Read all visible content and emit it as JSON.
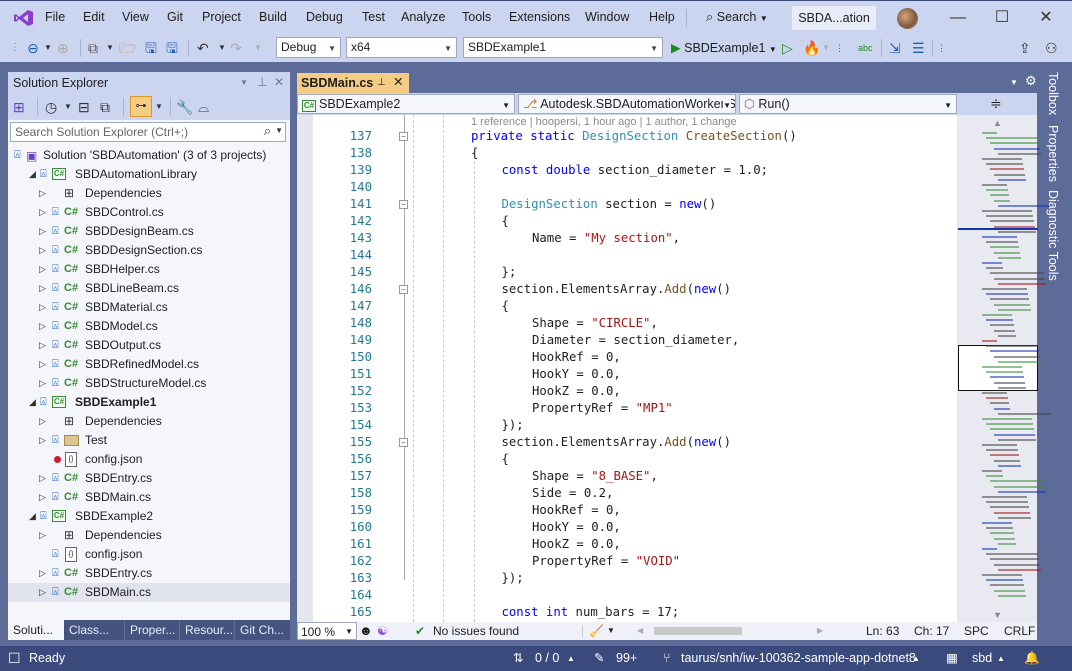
{
  "menu": {
    "items": [
      "File",
      "Edit",
      "View",
      "Git",
      "Project",
      "Build",
      "Debug",
      "Test",
      "Analyze",
      "Tools",
      "Extensions",
      "Window",
      "Help"
    ],
    "search_label": "Search",
    "title_pill": "SBDA...ation"
  },
  "toolbar": {
    "config": "Debug",
    "platform": "x64",
    "startup_project": "SBDExample1",
    "run_label": "SBDExample1"
  },
  "solution_explorer": {
    "title": "Solution Explorer",
    "search_placeholder": "Search Solution Explorer (Ctrl+;)",
    "tree": [
      {
        "label": "Solution 'SBDAutomation' (3 of 3 projects)",
        "kind": "solution",
        "level": 0
      },
      {
        "label": "SBDAutomationLibrary",
        "kind": "project",
        "level": 1,
        "expanded": true
      },
      {
        "label": "Dependencies",
        "kind": "deps",
        "level": 2
      },
      {
        "label": "SBDControl.cs",
        "kind": "cs",
        "level": 2
      },
      {
        "label": "SBDDesignBeam.cs",
        "kind": "cs",
        "level": 2
      },
      {
        "label": "SBDDesignSection.cs",
        "kind": "cs",
        "level": 2
      },
      {
        "label": "SBDHelper.cs",
        "kind": "cs",
        "level": 2
      },
      {
        "label": "SBDLineBeam.cs",
        "kind": "cs",
        "level": 2
      },
      {
        "label": "SBDMaterial.cs",
        "kind": "cs",
        "level": 2
      },
      {
        "label": "SBDModel.cs",
        "kind": "cs",
        "level": 2
      },
      {
        "label": "SBDOutput.cs",
        "kind": "cs",
        "level": 2
      },
      {
        "label": "SBDRefinedModel.cs",
        "kind": "cs",
        "level": 2
      },
      {
        "label": "SBDStructureModel.cs",
        "kind": "cs",
        "level": 2
      },
      {
        "label": "SBDExample1",
        "kind": "project",
        "level": 1,
        "expanded": true,
        "bold": true
      },
      {
        "label": "Dependencies",
        "kind": "deps",
        "level": 2
      },
      {
        "label": "Test",
        "kind": "folder",
        "level": 2
      },
      {
        "label": "config.json",
        "kind": "json-error",
        "level": 2
      },
      {
        "label": "SBDEntry.cs",
        "kind": "cs",
        "level": 2
      },
      {
        "label": "SBDMain.cs",
        "kind": "cs",
        "level": 2
      },
      {
        "label": "SBDExample2",
        "kind": "project",
        "level": 1,
        "expanded": true
      },
      {
        "label": "Dependencies",
        "kind": "deps",
        "level": 2
      },
      {
        "label": "config.json",
        "kind": "json",
        "level": 2
      },
      {
        "label": "SBDEntry.cs",
        "kind": "cs",
        "level": 2
      },
      {
        "label": "SBDMain.cs",
        "kind": "cs",
        "level": 2,
        "selected": true
      }
    ],
    "bottom_tabs": [
      "Soluti...",
      "Class...",
      "Proper...",
      "Resour...",
      "Git Ch..."
    ]
  },
  "editor": {
    "tab_label": "SBDMain.cs",
    "nav_project": "SBDExample2",
    "nav_class": "Autodesk.SBDAutomationWorker.S",
    "nav_member": "Run()",
    "codelens": "1 reference | hoopersi, 1 hour ago | 1 author, 1 change",
    "lines": [
      {
        "n": "137",
        "indent": 0,
        "tokens": [
          [
            "kw",
            "private static "
          ],
          [
            "ty",
            "DesignSection "
          ],
          [
            "fn",
            "CreateSection"
          ],
          [
            "",
            "()"
          ]
        ]
      },
      {
        "n": "138",
        "indent": 0,
        "tokens": [
          [
            "",
            "{"
          ]
        ]
      },
      {
        "n": "139",
        "indent": 1,
        "tokens": [
          [
            "kw",
            "const double "
          ],
          [
            "",
            "section_diameter = 1.0;"
          ]
        ]
      },
      {
        "n": "140",
        "indent": 0,
        "tokens": []
      },
      {
        "n": "141",
        "indent": 1,
        "tokens": [
          [
            "ty",
            "DesignSection "
          ],
          [
            "",
            "section = "
          ],
          [
            "kw",
            "new"
          ],
          [
            "",
            "()"
          ]
        ]
      },
      {
        "n": "142",
        "indent": 1,
        "tokens": [
          [
            "",
            "{"
          ]
        ]
      },
      {
        "n": "143",
        "indent": 2,
        "tokens": [
          [
            "",
            "Name = "
          ],
          [
            "st",
            "\"My section\""
          ],
          [
            "",
            ","
          ]
        ]
      },
      {
        "n": "144",
        "indent": 0,
        "tokens": []
      },
      {
        "n": "145",
        "indent": 1,
        "tokens": [
          [
            "",
            "};"
          ]
        ]
      },
      {
        "n": "146",
        "indent": 1,
        "tokens": [
          [
            "",
            "section.ElementsArray."
          ],
          [
            "fn",
            "Add"
          ],
          [
            "",
            "("
          ],
          [
            "kw",
            "new"
          ],
          [
            "",
            "()"
          ]
        ]
      },
      {
        "n": "147",
        "indent": 1,
        "tokens": [
          [
            "",
            "{"
          ]
        ]
      },
      {
        "n": "148",
        "indent": 2,
        "tokens": [
          [
            "",
            "Shape = "
          ],
          [
            "st",
            "\"CIRCLE\""
          ],
          [
            "",
            ","
          ]
        ]
      },
      {
        "n": "149",
        "indent": 2,
        "tokens": [
          [
            "",
            "Diameter = section_diameter,"
          ]
        ]
      },
      {
        "n": "150",
        "indent": 2,
        "tokens": [
          [
            "",
            "HookRef = 0,"
          ]
        ]
      },
      {
        "n": "151",
        "indent": 2,
        "tokens": [
          [
            "",
            "HookY = 0.0,"
          ]
        ]
      },
      {
        "n": "152",
        "indent": 2,
        "tokens": [
          [
            "",
            "HookZ = 0.0,"
          ]
        ]
      },
      {
        "n": "153",
        "indent": 2,
        "tokens": [
          [
            "",
            "PropertyRef = "
          ],
          [
            "st",
            "\"MP1\""
          ]
        ]
      },
      {
        "n": "154",
        "indent": 1,
        "tokens": [
          [
            "",
            "});"
          ]
        ]
      },
      {
        "n": "155",
        "indent": 1,
        "tokens": [
          [
            "",
            "section.ElementsArray."
          ],
          [
            "fn",
            "Add"
          ],
          [
            "",
            "("
          ],
          [
            "kw",
            "new"
          ],
          [
            "",
            "()"
          ]
        ]
      },
      {
        "n": "156",
        "indent": 1,
        "tokens": [
          [
            "",
            "{"
          ]
        ]
      },
      {
        "n": "157",
        "indent": 2,
        "tokens": [
          [
            "",
            "Shape = "
          ],
          [
            "st",
            "\"8_BASE\""
          ],
          [
            "",
            ","
          ]
        ]
      },
      {
        "n": "158",
        "indent": 2,
        "tokens": [
          [
            "",
            "Side = 0.2,"
          ]
        ]
      },
      {
        "n": "159",
        "indent": 2,
        "tokens": [
          [
            "",
            "HookRef = 0,"
          ]
        ]
      },
      {
        "n": "160",
        "indent": 2,
        "tokens": [
          [
            "",
            "HookY = 0.0,"
          ]
        ]
      },
      {
        "n": "161",
        "indent": 2,
        "tokens": [
          [
            "",
            "HookZ = 0.0,"
          ]
        ]
      },
      {
        "n": "162",
        "indent": 2,
        "tokens": [
          [
            "",
            "PropertyRef = "
          ],
          [
            "st",
            "\"VOID\""
          ]
        ]
      },
      {
        "n": "163",
        "indent": 1,
        "tokens": [
          [
            "",
            "});"
          ]
        ]
      },
      {
        "n": "164",
        "indent": 0,
        "tokens": []
      },
      {
        "n": "165",
        "indent": 1,
        "tokens": [
          [
            "kw",
            "const int "
          ],
          [
            "",
            "num_bars = 17;"
          ]
        ]
      }
    ],
    "folds_at": [
      "137",
      "141",
      "146",
      "155"
    ],
    "zoom": "100 %",
    "issues": "No issues found",
    "line": "Ln: 63",
    "col": "Ch: 17",
    "whitespace": "SPC",
    "eol": "CRLF"
  },
  "side_tabs": [
    "Toolbox",
    "Properties",
    "Diagnostic Tools"
  ],
  "status": {
    "ready": "Ready",
    "sync": "0 / 0",
    "changes": "99+",
    "branch": "taurus/snh/iw-100362-sample-app-dotnet8",
    "repo": "sbd"
  }
}
